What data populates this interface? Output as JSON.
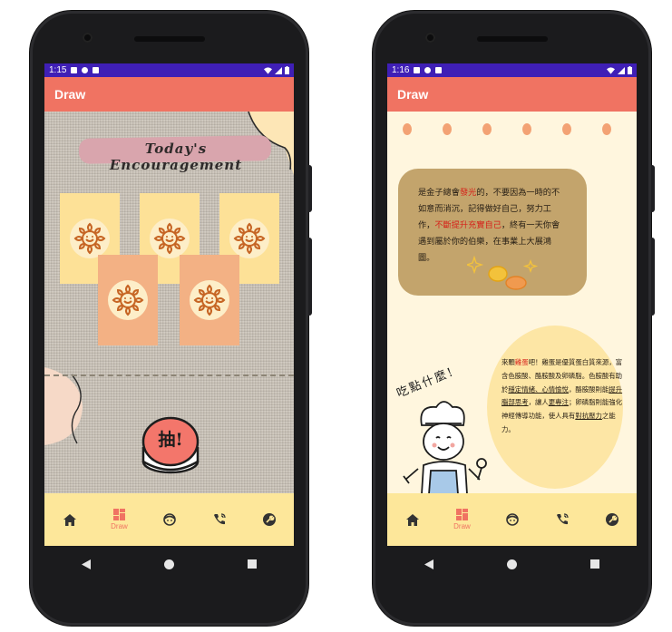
{
  "left_phone": {
    "status": {
      "time": "1:15"
    },
    "appbar": {
      "title": "Draw"
    },
    "banner": {
      "title": "Today's Encouragement"
    },
    "draw_button": {
      "label": "抽!"
    },
    "nav": [
      {
        "key": "home",
        "label": "",
        "icon": "home-icon"
      },
      {
        "key": "draw",
        "label": "Draw",
        "icon": "dashboard-icon"
      },
      {
        "key": "face",
        "label": "",
        "icon": "face-icon"
      },
      {
        "key": "call",
        "label": "",
        "icon": "phone-call-icon"
      },
      {
        "key": "build",
        "label": "",
        "icon": "wrench-icon"
      }
    ]
  },
  "right_phone": {
    "status": {
      "time": "1:16"
    },
    "appbar": {
      "title": "Draw"
    },
    "quote": {
      "p1": "是金子總會",
      "h1": "發光",
      "p2": "的，不要因為一時的不如意而消沉，記得做好自己，努力工作，",
      "h2": "不斷提升充實自己",
      "p3": "，終有一天你會遇到屬於你的伯樂，在事業上大展鴻圖。"
    },
    "tip": {
      "t1": "來顆",
      "h1": "雞蛋",
      "t2": "吧！雞蛋是優質蛋白質來源，富含色胺酸、酪胺酸及卵磷脂。色胺酸有助於",
      "u1": "穩定情緒、心情愉悅",
      "t3": "，酪胺酸則能",
      "u2": "提升腦部思考",
      "t4": "，讓人",
      "u3": "更專注",
      "t5": "；卵磷脂則能強化神經傳導功能，使人具有",
      "u4": "對抗壓力",
      "t6": "之能力。"
    },
    "handwriting": "吃點什麼!",
    "nav": [
      {
        "key": "home",
        "label": "",
        "icon": "home-icon"
      },
      {
        "key": "draw",
        "label": "Draw",
        "icon": "dashboard-icon"
      },
      {
        "key": "face",
        "label": "",
        "icon": "face-icon"
      },
      {
        "key": "call",
        "label": "",
        "icon": "phone-call-icon"
      },
      {
        "key": "build",
        "label": "",
        "icon": "wrench-icon"
      }
    ]
  },
  "colors": {
    "status_bar": "#3f1fb6",
    "app_bar": "#f07362",
    "bottom_nav": "#fde79a",
    "active_nav": "#f07362",
    "quote_box": "#c3a46c",
    "highlight_red": "#d6221a"
  }
}
